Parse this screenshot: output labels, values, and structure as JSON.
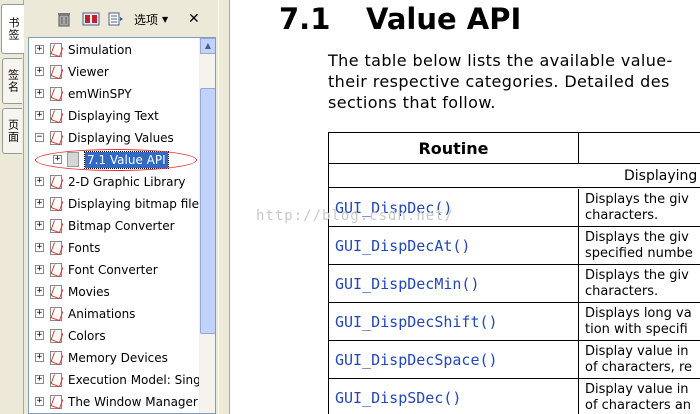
{
  "tabs": [
    {
      "label": "书签",
      "active": true
    },
    {
      "label": "签名",
      "active": false
    },
    {
      "label": "页面",
      "active": false
    }
  ],
  "toolbar": {
    "delete_icon": "trash-icon",
    "new_bookmark_icon": "bookmark-icon",
    "expand_icon": "expand-icon",
    "options_label": "选项",
    "close_label": "✕"
  },
  "bookmarks": [
    {
      "label": "Simulation"
    },
    {
      "label": "Viewer"
    },
    {
      "label": "emWinSPY"
    },
    {
      "label": "Displaying Text"
    },
    {
      "label": "Displaying Values"
    },
    {
      "label": "2-D Graphic Library"
    },
    {
      "label": "Displaying bitmap files"
    },
    {
      "label": "Bitmap Converter"
    },
    {
      "label": "Fonts"
    },
    {
      "label": "Font Converter"
    },
    {
      "label": "Movies"
    },
    {
      "label": "Animations"
    },
    {
      "label": "Colors"
    },
    {
      "label": "Memory Devices"
    },
    {
      "label": "Execution Model: Singl"
    },
    {
      "label": "The Window Manager"
    }
  ],
  "selected_child": {
    "label": "7.1 Value API"
  },
  "document": {
    "section_number": "7.1",
    "section_title": "Value API",
    "paragraph": "The table below lists the available value-\ntheir respective categories. Detailed des\nsections that follow.",
    "table_header": "Routine",
    "category": "Displaying",
    "watermark": "http://blog.csdn.net/",
    "rows": [
      {
        "routine": "GUI_DispDec()",
        "description": "Displays the giv\ncharacters."
      },
      {
        "routine": "GUI_DispDecAt()",
        "description": "Displays the giv\nspecified numbe"
      },
      {
        "routine": "GUI_DispDecMin()",
        "description": "Displays the giv\ncharacters."
      },
      {
        "routine": "GUI_DispDecShift()",
        "description": "Displays long va\ntion with specifi"
      },
      {
        "routine": "GUI_DispDecSpace()",
        "description": "Display value in\nof characters, re"
      },
      {
        "routine": "GUI_DispSDec()",
        "description": "Display value in\nof characters an"
      }
    ]
  }
}
